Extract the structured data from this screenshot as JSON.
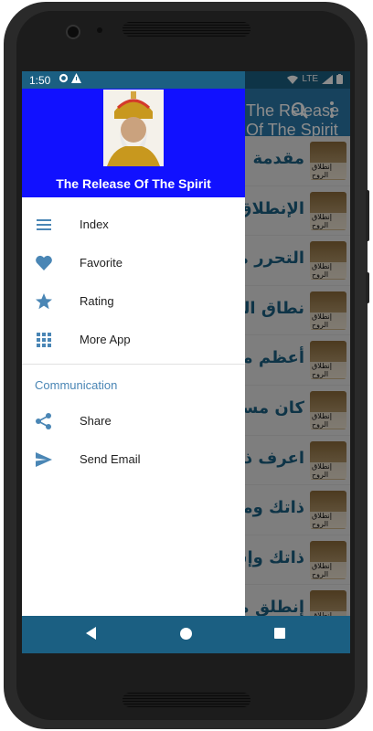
{
  "status_bar": {
    "time": "1:50",
    "network": "LTE"
  },
  "app_bar": {
    "title": "The Release Of The Spirit"
  },
  "list": {
    "thumbnail_caption": "إنطلاق الروح",
    "items": [
      "مقدمة",
      "الإنطلاق",
      "التحرر من",
      "نطاق الج",
      "أعظم من",
      "كان مست",
      "اعرف ذات",
      "ذاتك ومد",
      "ذاتك وإس",
      "إنطلق من"
    ]
  },
  "drawer": {
    "header_title": "The Release Of The Spirit",
    "menu": [
      {
        "label": "Index",
        "icon": "list-icon"
      },
      {
        "label": "Favorite",
        "icon": "heart-icon"
      },
      {
        "label": "Rating",
        "icon": "star-icon"
      },
      {
        "label": "More App",
        "icon": "grid-icon"
      }
    ],
    "section_label": "Communication",
    "communication": [
      {
        "label": "Share",
        "icon": "share-icon"
      },
      {
        "label": "Send Email",
        "icon": "send-icon"
      }
    ]
  },
  "colors": {
    "primary": "#2a78a9",
    "primary_dark": "#1b5f82",
    "drawer_header": "#1111ff",
    "accent_icon": "#4a86b5"
  }
}
